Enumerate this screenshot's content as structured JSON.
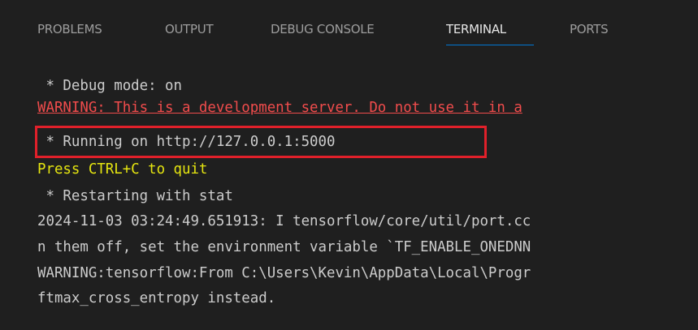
{
  "tabs": [
    {
      "label": "PROBLEMS",
      "active": false
    },
    {
      "label": "OUTPUT",
      "active": false
    },
    {
      "label": "DEBUG CONSOLE",
      "active": false
    },
    {
      "label": "TERMINAL",
      "active": true
    },
    {
      "label": "PORTS",
      "active": false
    }
  ],
  "terminal": {
    "lines": [
      {
        "text": " * Debug mode: on",
        "style": "normal"
      },
      {
        "text": "WARNING: This is a development server. Do not use it in a",
        "style": "warning"
      },
      {
        "text": " * Running on http://127.0.0.1:5000",
        "style": "normal",
        "highlighted": true
      },
      {
        "text": "Press CTRL+C to quit",
        "style": "yellow"
      },
      {
        "text": " * Restarting with stat",
        "style": "normal"
      },
      {
        "text": "2024-11-03 03:24:49.651913: I tensorflow/core/util/port.cc",
        "style": "normal"
      },
      {
        "text": "n them off, set the environment variable `TF_ENABLE_ONEDNN",
        "style": "normal"
      },
      {
        "text": "WARNING:tensorflow:From C:\\Users\\Kevin\\AppData\\Local\\Progr",
        "style": "normal"
      },
      {
        "text": "ftmax_cross_entropy instead.",
        "style": "normal"
      }
    ]
  },
  "colors": {
    "background": "#1f1f1f",
    "text": "#cccccc",
    "warning": "#f14c4c",
    "yellow": "#e5e510",
    "active_tab_underline": "#0078d4",
    "highlight_box": "#e0202a"
  }
}
